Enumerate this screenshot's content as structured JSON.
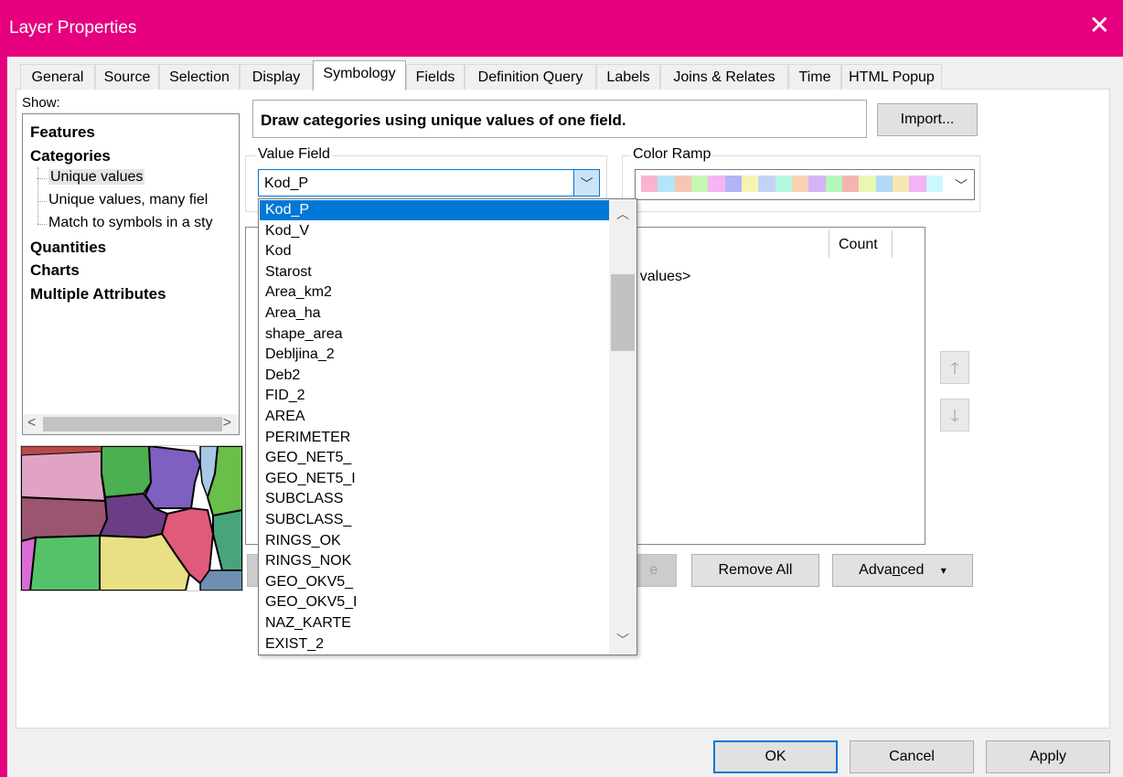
{
  "window": {
    "title": "Layer Properties",
    "close_label": "✕"
  },
  "tabs": [
    {
      "label": "General"
    },
    {
      "label": "Source"
    },
    {
      "label": "Selection"
    },
    {
      "label": "Display"
    },
    {
      "label": "Symbology",
      "active": true
    },
    {
      "label": "Fields"
    },
    {
      "label": "Definition Query"
    },
    {
      "label": "Labels"
    },
    {
      "label": "Joins & Relates"
    },
    {
      "label": "Time"
    },
    {
      "label": "HTML Popup"
    }
  ],
  "show": {
    "label": "Show:",
    "items": {
      "features": "Features",
      "categories": "Categories",
      "unique_values": "Unique values",
      "unique_values_many": "Unique values, many fiel",
      "match_symbols": "Match to symbols in a sty",
      "quantities": "Quantities",
      "charts": "Charts",
      "multiple_attributes": "Multiple Attributes"
    },
    "scroll_left": "<",
    "scroll_right": ">"
  },
  "description": "Draw categories using unique values of one field.",
  "import_label": "Import...",
  "value_field": {
    "title": "Value Field",
    "selected": "Kod_P",
    "options": [
      "Kod_P",
      "Kod_V",
      "Kod",
      "Starost",
      "Area_km2",
      "Area_ha",
      "shape_area",
      "Debljina_2",
      "Deb2",
      "FID_2",
      "AREA",
      "PERIMETER",
      "GEO_NET5_",
      "GEO_NET5_I",
      "SUBCLASS",
      "SUBCLASS_",
      "RINGS_OK",
      "RINGS_NOK",
      "GEO_OKV5_",
      "GEO_OKV5_I",
      "NAZ_KARTE",
      "EXIST_2"
    ]
  },
  "color_ramp": {
    "title": "Color Ramp",
    "colors": [
      "#f9b3d0",
      "#b3e6f7",
      "#f7c6b3",
      "#c6f7b3",
      "#f7b3f2",
      "#b3b3f7",
      "#f7f3b3",
      "#c3d3f7",
      "#b3f7e0",
      "#f7d3b3",
      "#d6b3f7",
      "#b3f7b9",
      "#f7b3b3",
      "#e9f7b3",
      "#b3d9f7",
      "#f7e7b3",
      "#f3b3f7",
      "#ccf7ff"
    ]
  },
  "values_table": {
    "count_header": "Count",
    "other_values": "r values>"
  },
  "buttons": {
    "remove_partial": "e",
    "remove_all": "Remove All",
    "advanced": "Advanced",
    "advanced_mnemonic_pre": "Adva",
    "advanced_mnemonic_char": "n",
    "advanced_mnemonic_post": "ced",
    "advanced_arrow": "▾",
    "ok": "OK",
    "cancel": "Cancel",
    "apply": "Apply",
    "move_up": "🡑",
    "move_down": "🡓"
  }
}
